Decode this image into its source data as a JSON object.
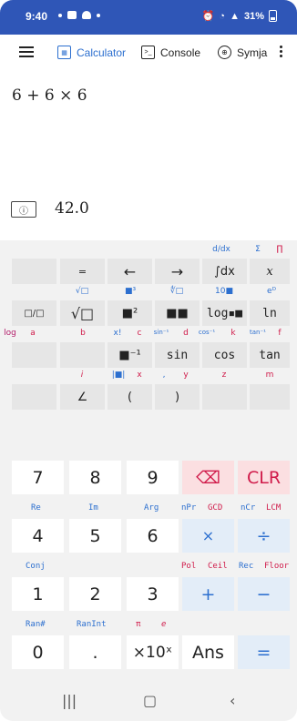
{
  "status": {
    "time": "9:40",
    "battery": "31%"
  },
  "tabs": [
    {
      "label": "Calculator"
    },
    {
      "label": "Console"
    },
    {
      "label": "Symja"
    }
  ],
  "display": {
    "expression": "6 + 6 × 6",
    "result": "42.0"
  },
  "sci_top_labels": [
    "d/dx",
    "Σ",
    "∏"
  ],
  "sci_rows": [
    [
      "",
      "=",
      "←",
      "→",
      "∫dx",
      "x"
    ],
    [
      "□/□",
      "√□",
      "■²",
      "■■",
      "log▪■",
      "ln"
    ],
    [
      "",
      "",
      "■⁻¹",
      "sin",
      "cos",
      "tan"
    ],
    [
      "",
      "∠",
      "(",
      ")",
      "",
      ""
    ]
  ],
  "sci_sub_row1": [
    "√□",
    "■³",
    "∜□",
    "10■",
    "eᴰ"
  ],
  "sci_sub_row2": [
    "log",
    "a",
    "b",
    "x!",
    "c",
    "sin⁻¹",
    "d",
    "cos⁻¹",
    "k",
    "tan⁻¹",
    "f"
  ],
  "sci_sub_row3": [
    "i",
    "|■|",
    "x",
    ",",
    "y",
    "z",
    "m"
  ],
  "num_rows": [
    [
      "7",
      "8",
      "9",
      "⌫",
      "CLR"
    ],
    [
      "4",
      "5",
      "6",
      "×",
      "÷"
    ],
    [
      "1",
      "2",
      "3",
      "+",
      "−"
    ],
    [
      "0",
      ".",
      "×10ˣ",
      "Ans",
      "="
    ]
  ],
  "num_sub1": [
    "Re",
    "Im",
    "Arg",
    "nPr",
    "GCD",
    "nCr",
    "LCM"
  ],
  "num_sub2": [
    "Conj",
    "Pol",
    "Ceil",
    "Rec",
    "Floor"
  ],
  "num_sub3": [
    "Ran#",
    "RanInt",
    "π",
    "e"
  ],
  "colors": {
    "statusbar": "#2f56b7",
    "accent": "#2c6fcf",
    "red": "#d01b4a"
  }
}
